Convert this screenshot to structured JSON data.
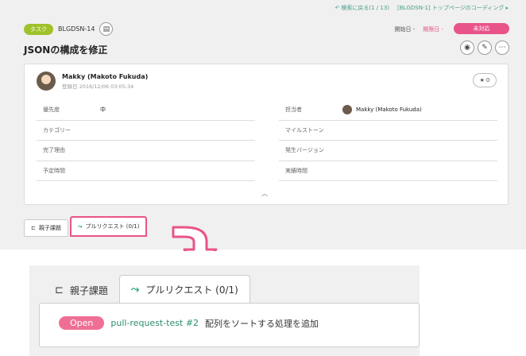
{
  "topnav": {
    "back_label": "検索に戻る(1 / 13)",
    "next_label": "[BLGDSN-1] トップページのコーディング ▸"
  },
  "issue": {
    "type": "タスク",
    "key": "BLGDSN-14",
    "title": "JSONの構成を修正",
    "start_label": "開始日 -",
    "due_label": "期限日 -",
    "status": "未対応",
    "star_count": "0"
  },
  "author": {
    "name": "Makky (Makoto Fukuda)",
    "registered": "登録日 2016/12/06 03:05:34"
  },
  "properties": [
    {
      "left_label": "優先度",
      "left_value": "中",
      "right_label": "担当者",
      "right_value": "Makky (Makoto Fukuda)"
    },
    {
      "left_label": "カテゴリー",
      "left_value": "",
      "right_label": "マイルストーン",
      "right_value": ""
    },
    {
      "left_label": "完了理由",
      "left_value": "",
      "right_label": "発生バージョン",
      "right_value": ""
    },
    {
      "left_label": "予定時間",
      "left_value": "",
      "right_label": "実績時間",
      "right_value": ""
    }
  ],
  "tabs": {
    "parent_child": "親子課題",
    "pull_request": "プルリクエスト (0/1)"
  },
  "pull_request": {
    "status": "Open",
    "link": "pull-request-test #2",
    "description": "配列をソートする処理を追加"
  },
  "colors": {
    "accent_pink": "#e8548a",
    "green": "#2b8f6b",
    "type_badge": "#9fc22a"
  }
}
